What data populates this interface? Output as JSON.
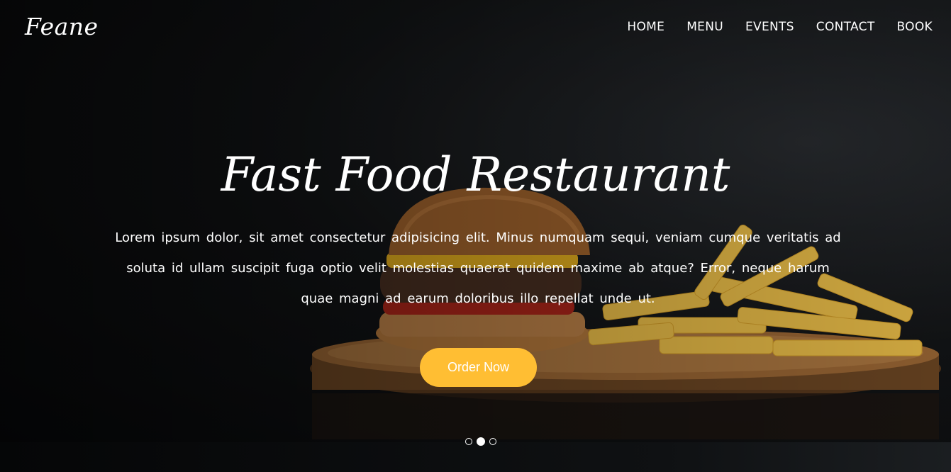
{
  "header": {
    "logo": "Feane",
    "nav": [
      {
        "label": "HOME"
      },
      {
        "label": "MENU"
      },
      {
        "label": "EVENTS"
      },
      {
        "label": "CONTACT"
      },
      {
        "label": "BOOK"
      }
    ]
  },
  "hero": {
    "title": "Fast Food Restaurant",
    "description": "Lorem ipsum dolor, sit amet consectetur adipisicing elit. Minus numquam sequi, veniam cumque veritatis ad soluta id ullam suscipit fuga optio velit molestias quaerat quidem maxime ab atque? Error, neque harum quae magni ad earum doloribus illo repellat unde ut.",
    "cta_label": "Order Now",
    "background_image": "burger-and-fries-on-wooden-board",
    "carousel": {
      "slides": 3,
      "active_index": 1
    }
  },
  "colors": {
    "accent": "#ffbe33",
    "text": "#ffffff",
    "background": "#0b0c0e"
  }
}
